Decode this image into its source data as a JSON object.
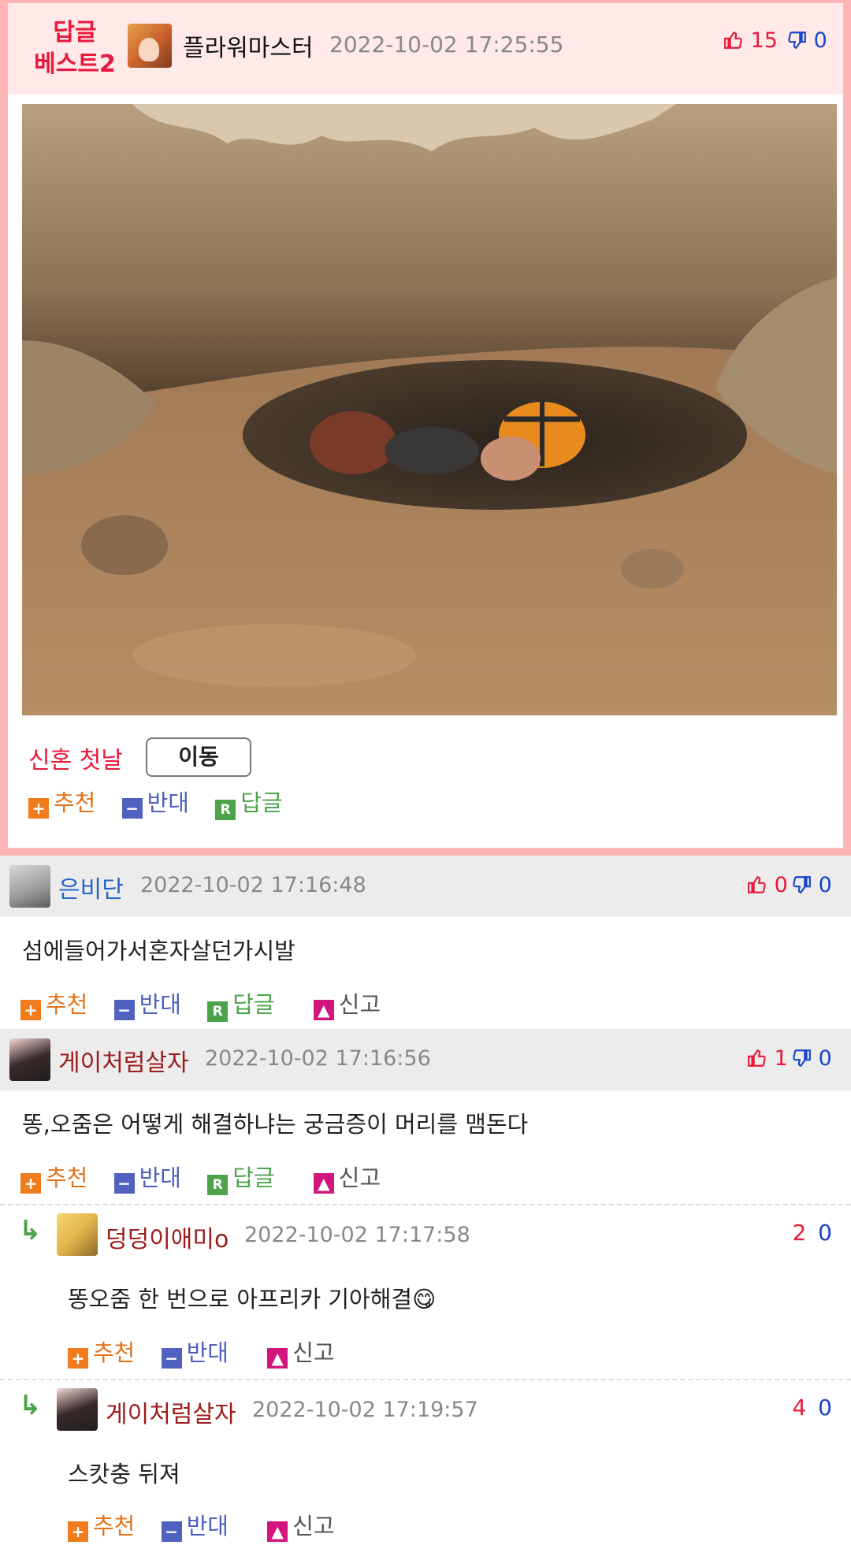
{
  "best": {
    "badge_line1": "답글",
    "badge_line2": "베스트2",
    "author": "플라워마스터",
    "datetime": "2022-10-02 17:25:55",
    "likes": "15",
    "dislikes": "0",
    "title": "신혼 첫날",
    "move_label": "이동",
    "actions": {
      "recommend": "추천",
      "oppose": "반대",
      "reply": "답글"
    }
  },
  "comments": [
    {
      "author": "은비단",
      "author_color": "#2a64c8",
      "datetime": "2022-10-02 17:16:48",
      "likes": "0",
      "dislikes": "0",
      "text": "섬에들어가서혼자살던가시발",
      "actions": {
        "recommend": "추천",
        "oppose": "반대",
        "reply": "답글",
        "report": "신고"
      }
    },
    {
      "author": "게이처럼살자",
      "author_color": "#9c1b1b",
      "datetime": "2022-10-02 17:16:56",
      "likes": "1",
      "dislikes": "0",
      "text": "똥,오줌은 어떻게 해결하냐는 궁금증이 머리를 맴돈다",
      "actions": {
        "recommend": "추천",
        "oppose": "반대",
        "reply": "답글",
        "report": "신고"
      }
    }
  ],
  "replies": [
    {
      "author": "덩덩이애미o",
      "author_color": "#9c1b1b",
      "datetime": "2022-10-02 17:17:58",
      "likes": "2",
      "dislikes": "0",
      "text": "똥오줌 한 번으로 아프리카 기아해결😋",
      "actions": {
        "recommend": "추천",
        "oppose": "반대",
        "report": "신고"
      }
    },
    {
      "author": "게이처럼살자",
      "author_color": "#9c1b1b",
      "datetime": "2022-10-02 17:19:57",
      "likes": "4",
      "dislikes": "0",
      "text": "스캇충 뒤져",
      "actions": {
        "recommend": "추천",
        "oppose": "반대",
        "report": "신고"
      }
    }
  ],
  "icons": {
    "thumb_up": "thumbs-up-icon",
    "thumb_down": "thumbs-down-icon",
    "plus": "plus-icon",
    "minus": "minus-icon",
    "reply": "reply-icon",
    "report": "siren-icon",
    "reply_arrow": "reply-arrow-icon"
  },
  "colors": {
    "accent_red": "#e8193c",
    "accent_blue": "#1846c8",
    "best_border": "#ffb5b5",
    "best_header_bg": "#ffe9e9",
    "recommend": "#e3741c",
    "oppose": "#4d5fbf",
    "reply": "#4ca34a",
    "report": "#d2167d"
  }
}
